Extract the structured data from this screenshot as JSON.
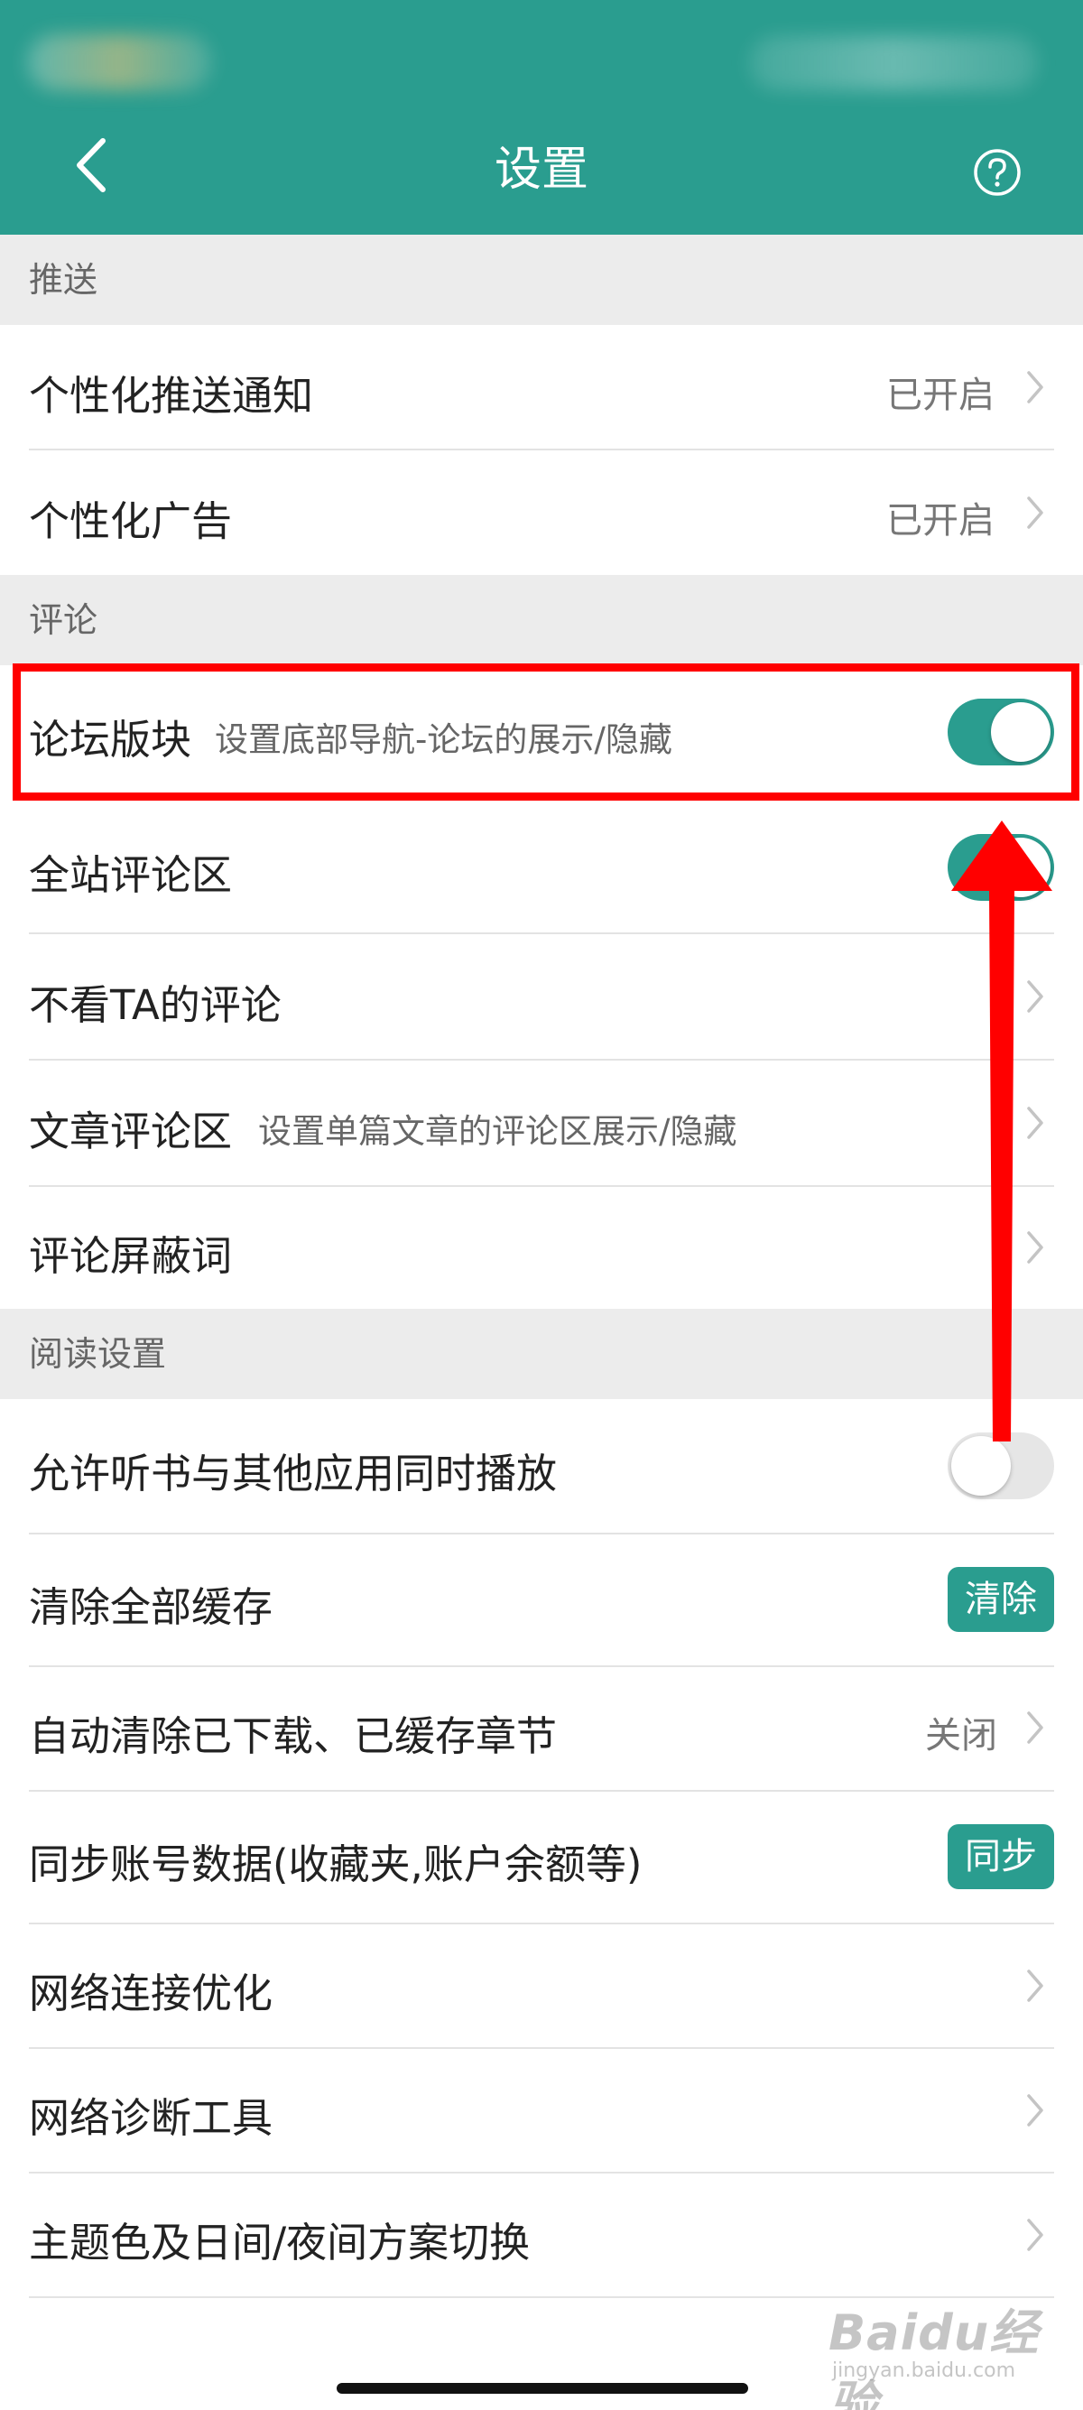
{
  "header": {
    "title": "设置",
    "back_icon": "chevron-left-icon",
    "help_icon": "question-circle-icon"
  },
  "colors": {
    "accent": "#2a9d8f",
    "annotation": "#ff0000"
  },
  "sections": {
    "push": {
      "title": "推送",
      "personalized_push": {
        "label": "个性化推送通知",
        "value": "已开启"
      },
      "personalized_ads": {
        "label": "个性化广告",
        "value": "已开启"
      }
    },
    "comments": {
      "title": "评论",
      "forum_section": {
        "label": "论坛版块",
        "sub": "设置底部导航-论坛的展示/隐藏",
        "toggle_on": true
      },
      "site_comments": {
        "label": "全站评论区",
        "toggle_on": true
      },
      "hide_user_comments": {
        "label": "不看TA的评论"
      },
      "article_comments": {
        "label": "文章评论区",
        "sub": "设置单篇文章的评论区展示/隐藏"
      },
      "blocked_words": {
        "label": "评论屏蔽词"
      }
    },
    "reading": {
      "title": "阅读设置",
      "audio_mix": {
        "label": "允许听书与其他应用同时播放",
        "toggle_on": false
      },
      "clear_cache": {
        "label": "清除全部缓存",
        "button": "清除"
      },
      "auto_clear": {
        "label": "自动清除已下载、已缓存章节",
        "value": "关闭"
      },
      "sync_account": {
        "label": "同步账号数据(收藏夹,账户余额等)",
        "button": "同步"
      },
      "network_opt": {
        "label": "网络连接优化"
      },
      "network_diag": {
        "label": "网络诊断工具"
      },
      "theme_switch": {
        "label": "主题色及日间/夜间方案切换"
      }
    }
  },
  "watermark": {
    "logo": "Baidu经验",
    "sub": "jingyan.baidu.com"
  }
}
